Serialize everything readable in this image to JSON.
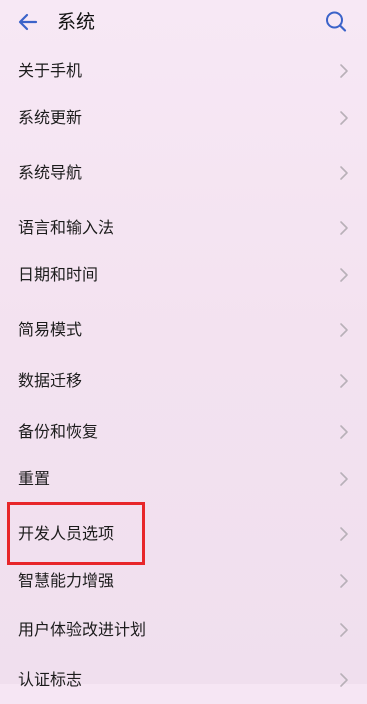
{
  "header": {
    "title": "系统"
  },
  "menu": {
    "items": [
      {
        "label": "关于手机"
      },
      {
        "label": "系统更新"
      },
      {
        "label": "系统导航"
      },
      {
        "label": "语言和输入法"
      },
      {
        "label": "日期和时间"
      },
      {
        "label": "简易模式"
      },
      {
        "label": "数据迁移"
      },
      {
        "label": "备份和恢复"
      },
      {
        "label": "重置"
      },
      {
        "label": "开发人员选项"
      },
      {
        "label": "智慧能力增强"
      },
      {
        "label": "用户体验改进计划"
      },
      {
        "label": "认证标志"
      }
    ]
  },
  "annotation": {
    "highlight_color": "#e8262a",
    "highlighted_item": "开发人员选项"
  },
  "colors": {
    "background": "#f6e6f4",
    "icon": "#3b63c9",
    "chevron": "#b8b0b8"
  },
  "icons": {
    "back": "back-arrow-icon",
    "search": "search-icon",
    "chevron": "chevron-right-icon"
  }
}
